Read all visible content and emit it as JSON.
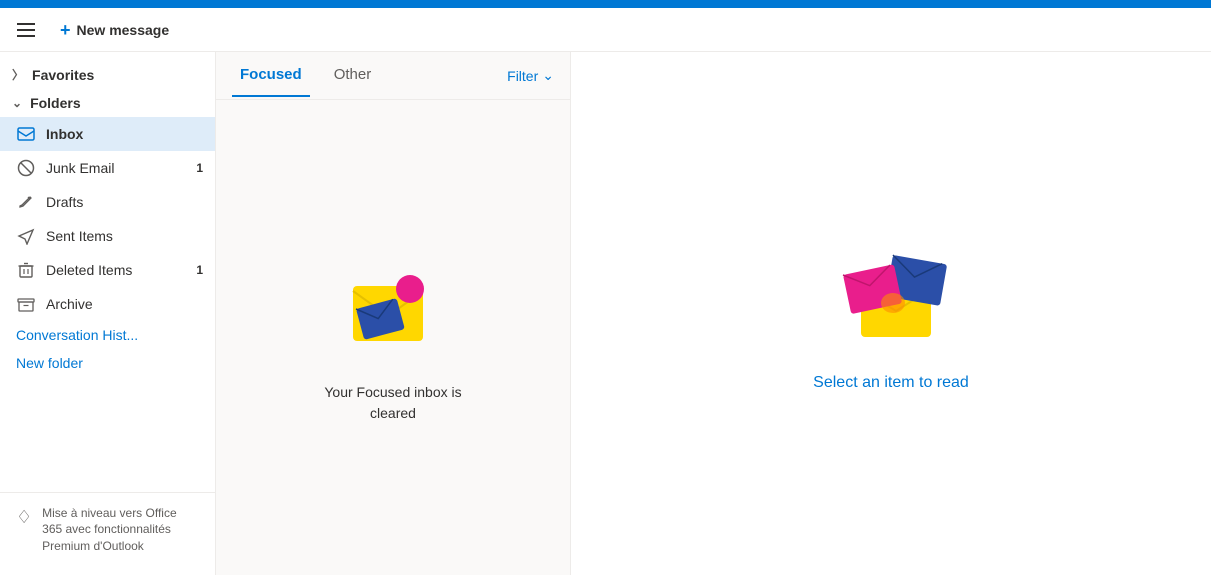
{
  "topbar": {
    "color": "#0078d4"
  },
  "header": {
    "new_message_label": "New message"
  },
  "sidebar": {
    "favorites_label": "Favorites",
    "folders_label": "Folders",
    "items": [
      {
        "id": "inbox",
        "label": "Inbox",
        "icon": "📥",
        "badge": "",
        "active": true
      },
      {
        "id": "junk",
        "label": "Junk Email",
        "icon": "🚫",
        "badge": "1",
        "active": false
      },
      {
        "id": "drafts",
        "label": "Drafts",
        "icon": "✏️",
        "badge": "",
        "active": false
      },
      {
        "id": "sent",
        "label": "Sent Items",
        "icon": "▷",
        "badge": "",
        "active": false
      },
      {
        "id": "deleted",
        "label": "Deleted Items",
        "icon": "🗑",
        "badge": "1",
        "active": false
      },
      {
        "id": "archive",
        "label": "Archive",
        "icon": "☰",
        "badge": "",
        "active": false
      }
    ],
    "conversation_hist_label": "Conversation Hist...",
    "new_folder_label": "New folder",
    "upgrade_text": "Mise à niveau vers Office 365 avec fonctionnalités Premium d'Outlook"
  },
  "email_panel": {
    "tabs": [
      {
        "id": "focused",
        "label": "Focused",
        "active": true
      },
      {
        "id": "other",
        "label": "Other",
        "active": false
      }
    ],
    "filter_label": "Filter",
    "empty_state_text": "Your Focused inbox is\ncleared"
  },
  "reading_pane": {
    "select_item_text": "Select an item to read"
  }
}
